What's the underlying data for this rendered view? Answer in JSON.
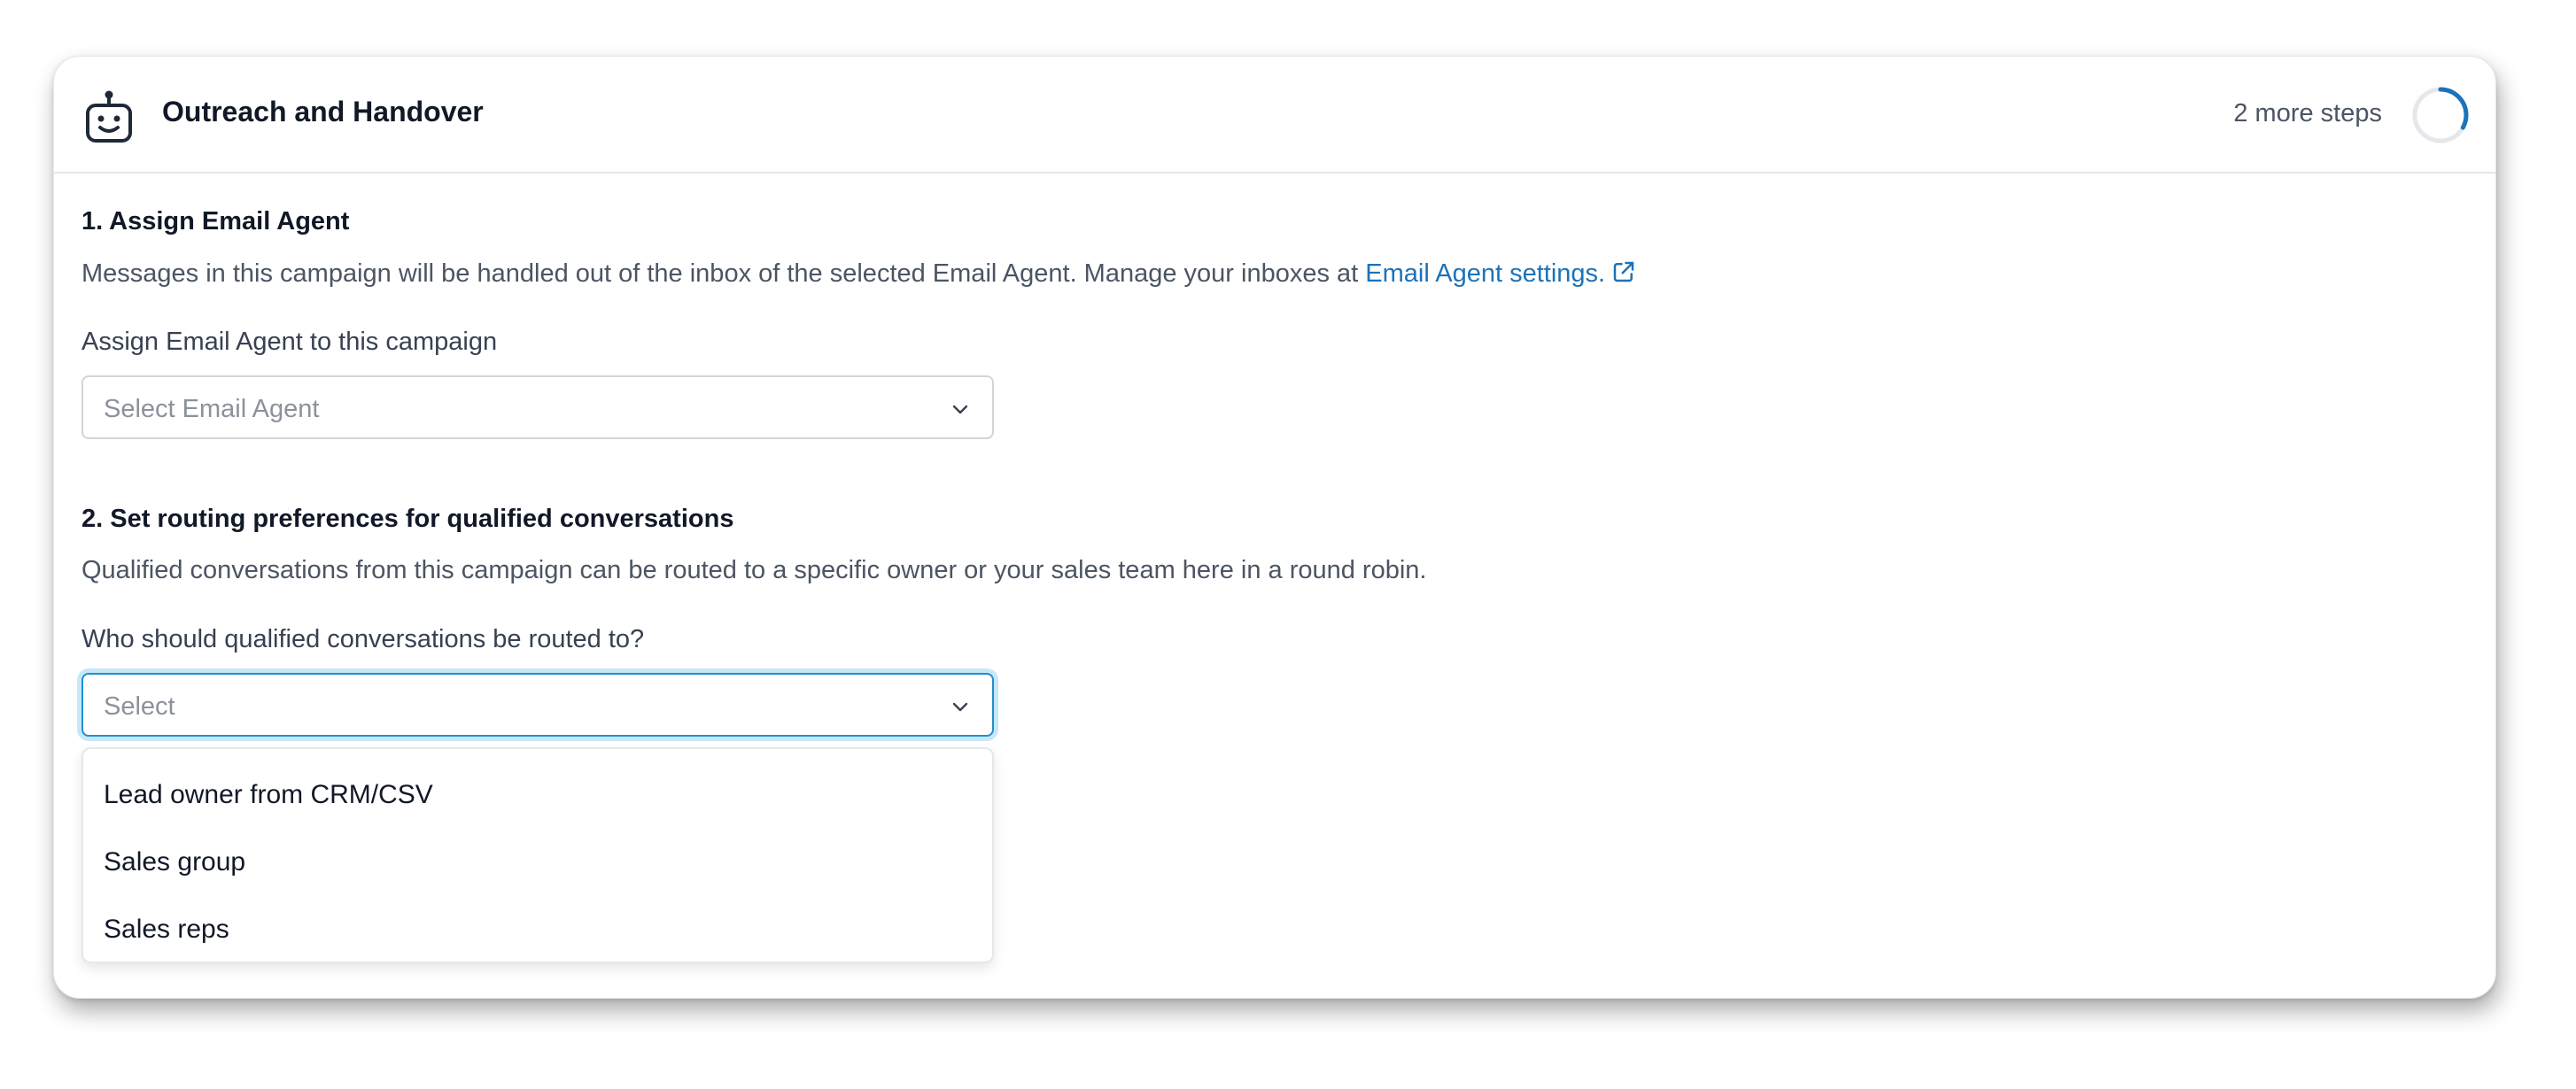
{
  "header": {
    "title": "Outreach and Handover",
    "steps_remaining": "2 more steps",
    "progress_fraction": 0.33,
    "accent_color": "#1d72b8"
  },
  "section1": {
    "title": "1. Assign Email Agent",
    "description": "Messages in this campaign will be handled out of the inbox of the selected Email Agent. Manage your inboxes at ",
    "link_text": "Email Agent settings.",
    "field_label": "Assign Email Agent to this campaign",
    "select_placeholder": "Select Email Agent"
  },
  "section2": {
    "title": "2. Set routing preferences for qualified conversations",
    "description": "Qualified conversations from this campaign can be routed to a specific owner or your sales team here in a round robin.",
    "field_label": "Who should qualified conversations be routed to?",
    "select_placeholder": "Select",
    "options": [
      "Lead owner from CRM/CSV",
      "Sales group",
      "Sales reps"
    ]
  },
  "icons": {
    "header": "robot-icon",
    "link": "external-link-icon",
    "select": "chevron-down-icon"
  }
}
